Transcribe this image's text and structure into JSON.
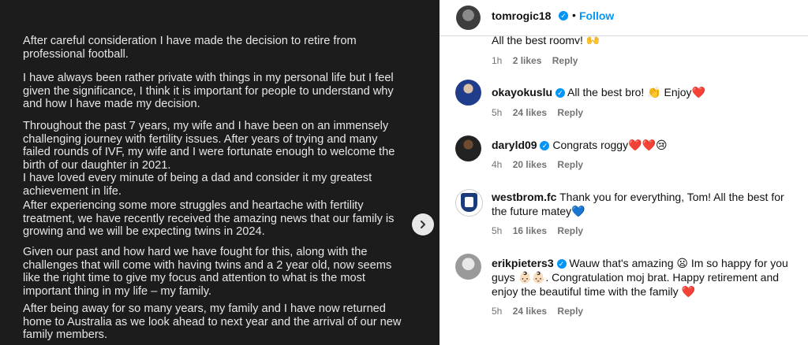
{
  "post": {
    "paragraphs": [
      "After careful consideration I have made the decision to retire from professional football.",
      "I have always been rather private with things in my personal life but I feel given the significance, I think it is important for people to understand why and how I have made my decision.",
      "Throughout the past 7 years, my wife and I have been on an immensely challenging journey with fertility issues. After years of trying and many failed rounds of IVF, my wife and I were fortunate enough to welcome the birth of our daughter in 2021.\nI have loved every minute of being a dad and consider it my greatest achievement in life.",
      "After experiencing some more struggles and heartache with fertility treatment, we have recently received the amazing news that our family is growing and we will be expecting twins in 2024.",
      "Given our past and how hard we have fought for this, along with the challenges that will come with having twins and a 2 year old, now seems like the right time to give my focus and attention to what is the most important thing in my life – my family.",
      "After being away for so many years, my family and I have now returned home to Australia  as we look ahead to next year  and the arrival of our new family members."
    ]
  },
  "header": {
    "username": "tomrogic18",
    "dot": "•",
    "follow_label": "Follow"
  },
  "partial_comment": {
    "text": "All the best roomy! 🙌",
    "time": "1h",
    "likes": "2 likes",
    "reply": "Reply"
  },
  "comments": [
    {
      "user": "okayokuslu",
      "text": "All the best bro! 👏 Enjoy❤️",
      "time": "5h",
      "likes": "24 likes",
      "reply": "Reply"
    },
    {
      "user": "daryld09",
      "text": "Congrats roggy❤️❤️😢",
      "time": "4h",
      "likes": "20 likes",
      "reply": "Reply"
    },
    {
      "user": "westbrom.fc",
      "text": "Thank you for everything, Tom! All the best for the future matey💙",
      "time": "5h",
      "likes": "16 likes",
      "reply": "Reply"
    },
    {
      "user": "erikpieters3",
      "text": "Wauw that's amazing 😦 Im so happy for you guys 👶🏻👶🏻. Congratulation moj brat. Happy retirement and enjoy the beautiful time with the family ❤️",
      "time": "5h",
      "likes": "24 likes",
      "reply": "Reply"
    }
  ],
  "icons": {
    "next": "chevron-right-icon",
    "verified": "verified-badge-icon"
  },
  "colors": {
    "accent": "#0095f6",
    "panel_bg": "#1c1c1c",
    "meta_text": "#737373"
  }
}
